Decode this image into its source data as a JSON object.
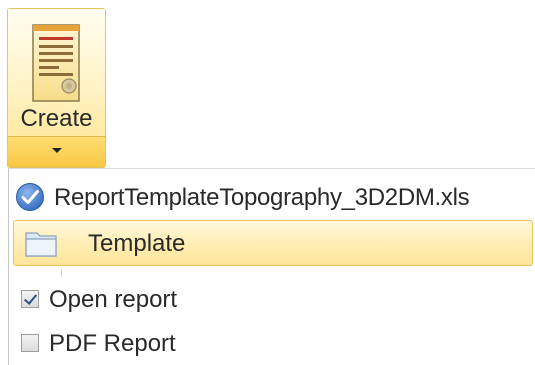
{
  "create_button": {
    "label": "Create",
    "icon": "report-document-icon",
    "dropdown_icon": "caret-down-icon"
  },
  "menu": {
    "file_item": {
      "label": "ReportTemplateTopography_3D2DM.xls",
      "icon": "checkmark-circle-icon"
    },
    "template_item": {
      "label": "Template",
      "icon": "folder-icon",
      "highlighted": true
    },
    "options": [
      {
        "label": "Open report",
        "checked": true
      },
      {
        "label": "PDF Report",
        "checked": false
      }
    ]
  },
  "colors": {
    "highlight_fill": "#ffeeb5",
    "highlight_border": "#e8c35f",
    "check_blue": "#3b78c9"
  }
}
